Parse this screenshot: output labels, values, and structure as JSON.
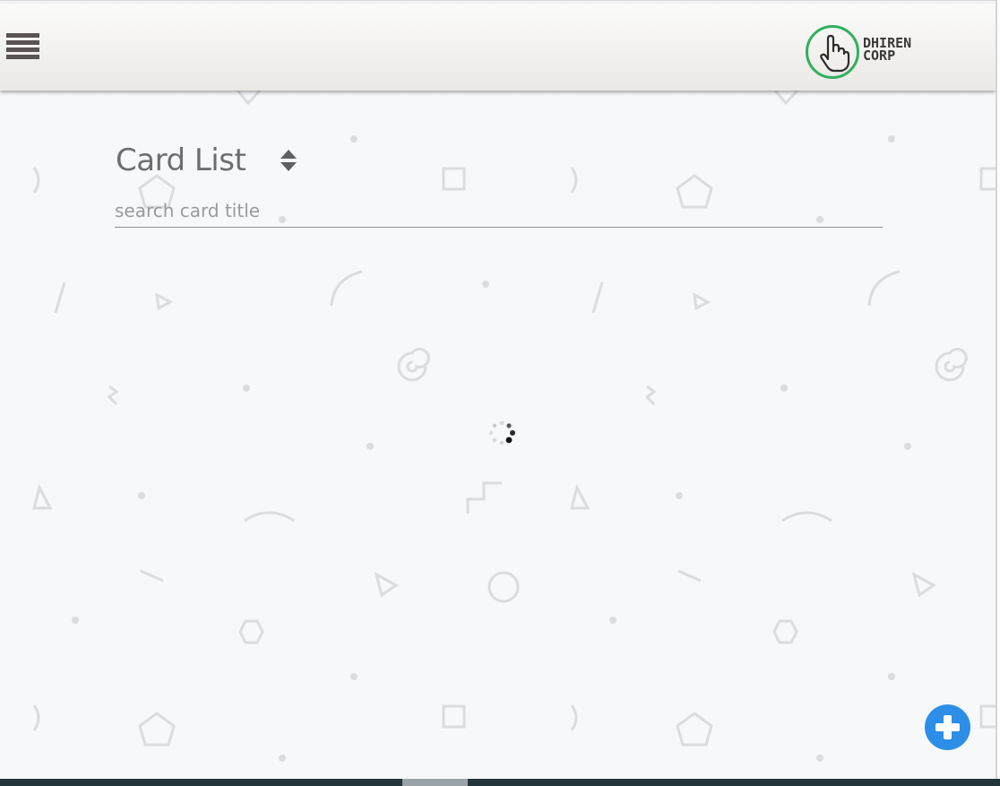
{
  "header": {
    "menu_icon": "hamburger-menu-icon",
    "logo": {
      "icon": "pointing-hand-icon",
      "line1": "DHIREN",
      "line2": "CORP",
      "ring_color": "#2fb061"
    }
  },
  "main": {
    "title": "Card List",
    "sort_icon": "sort-up-down-icon",
    "search": {
      "placeholder": "search card title",
      "value": ""
    },
    "loading_icon": "loading-spinner-icon"
  },
  "fab": {
    "icon": "plus-icon",
    "color": "#2c8ee6"
  },
  "colors": {
    "background": "#f7f8fa",
    "header_top": "#fbfbfa",
    "header_bottom": "#ebe9e5",
    "title_text": "#6f6e6e",
    "bottom_bar": "#23343a"
  }
}
